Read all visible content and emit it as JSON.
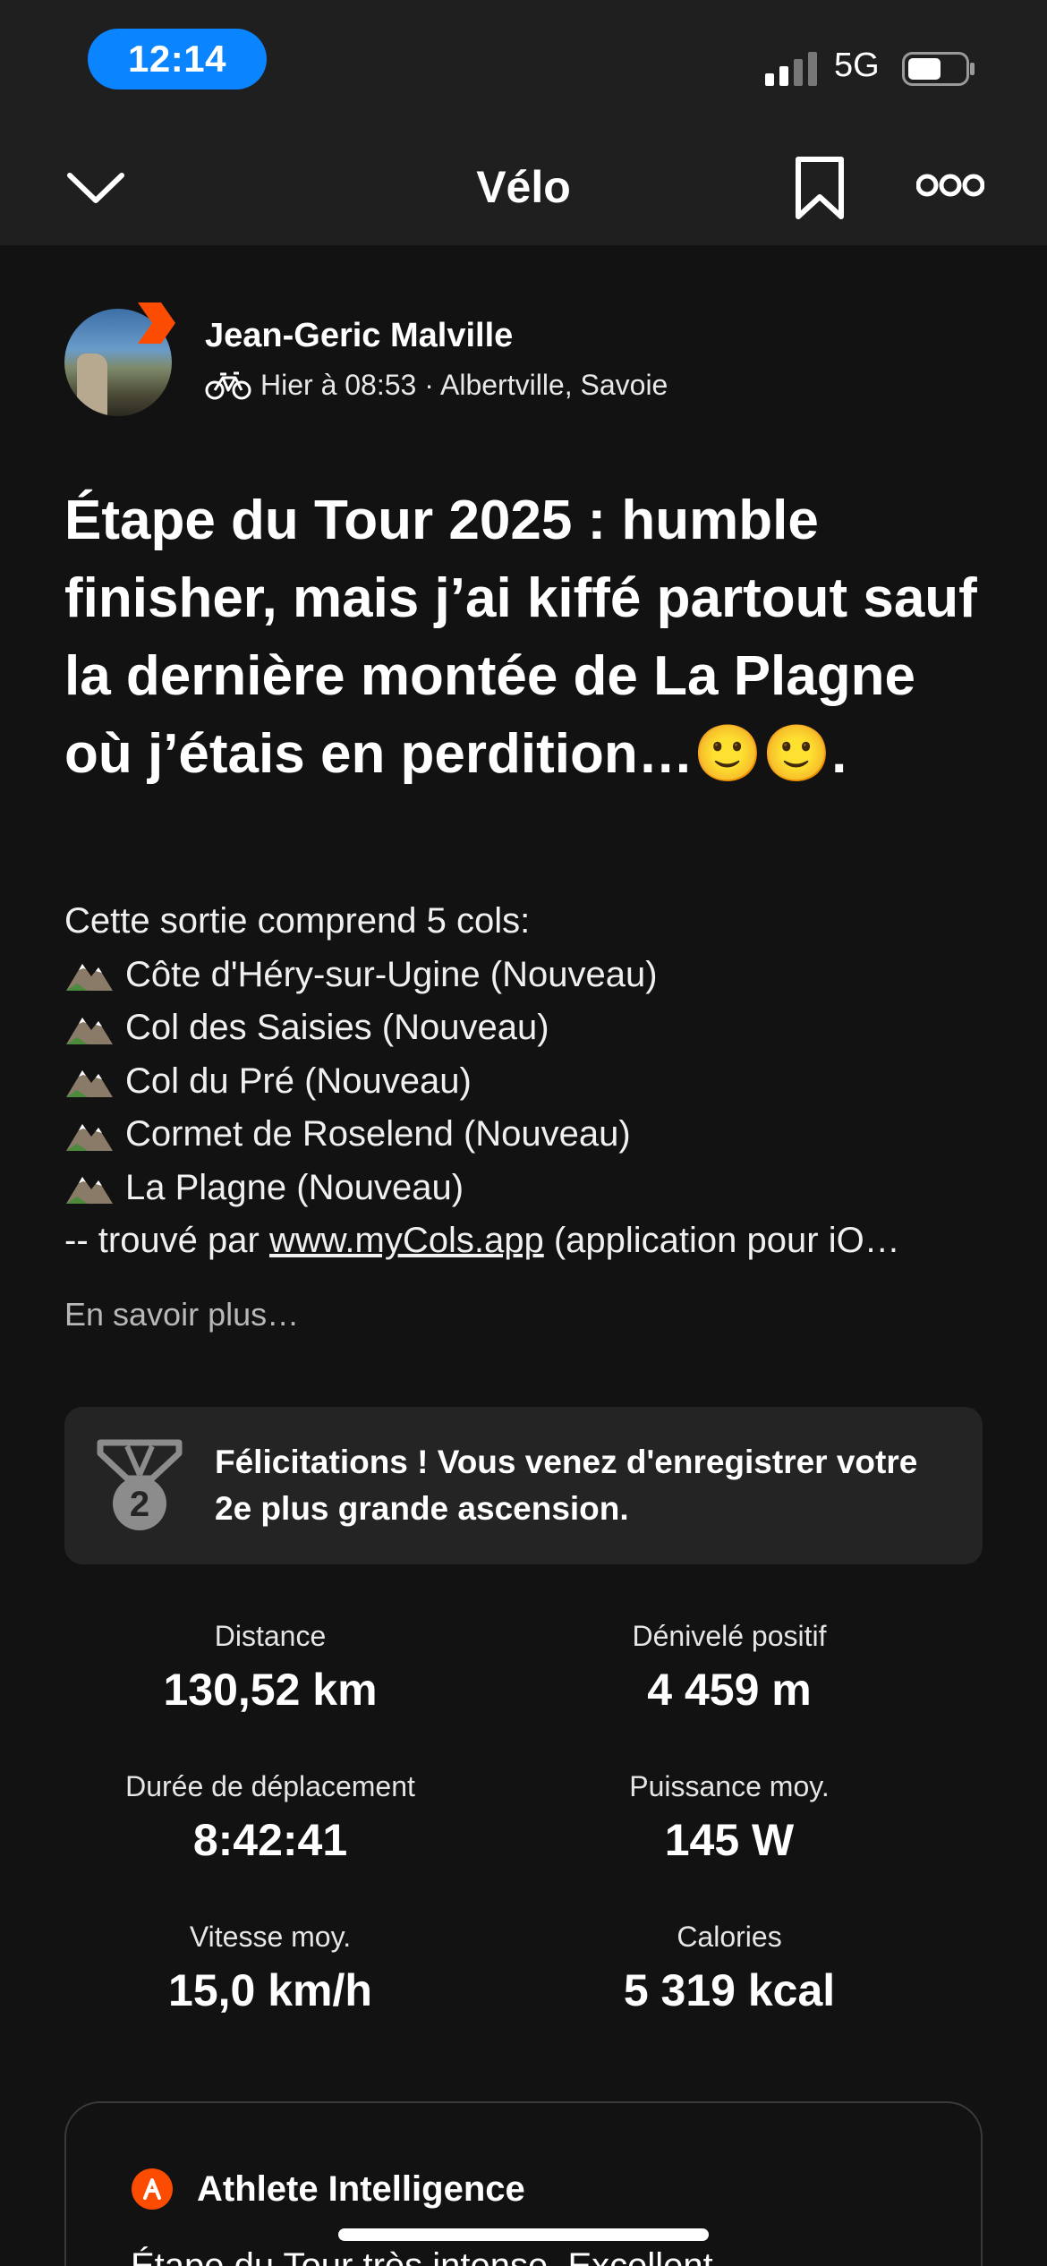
{
  "status_bar": {
    "time": "12:14",
    "network": "5G"
  },
  "nav": {
    "title": "Vélo"
  },
  "author": {
    "name": "Jean-Geric Malville",
    "meta": "Hier à 08:53 · Albertville, Savoie"
  },
  "post": {
    "title": "Étape du Tour 2025 : humble finisher, mais j’ai kiffé partout sauf la dernière montée de La Plagne où j’étais en perdition…🙂🙂.",
    "intro": "Cette sortie comprend 5 cols:",
    "cols": [
      "Côte d'Héry-sur-Ugine (Nouveau)",
      "Col des Saisies (Nouveau)",
      "Col du Pré (Nouveau)",
      "Cormet de Roselend (Nouveau)",
      "La Plagne (Nouveau)"
    ],
    "found_prefix": "-- trouvé par ",
    "found_link": "www.myCols.app",
    "found_suffix": " (application pour iO…",
    "read_more": "En savoir plus…"
  },
  "achievement": {
    "medal_number": "2",
    "text": "Félicitations ! Vous venez d'enregistrer votre 2e plus grande ascension."
  },
  "stats": [
    {
      "label": "Distance",
      "value": "130,52 km"
    },
    {
      "label": "Dénivelé positif",
      "value": "4 459 m"
    },
    {
      "label": "Durée de déplacement",
      "value": "8:42:41"
    },
    {
      "label": "Puissance moy.",
      "value": "145 W"
    },
    {
      "label": "Vitesse moy.",
      "value": "15,0 km/h"
    },
    {
      "label": "Calories",
      "value": "5 319 kcal"
    }
  ],
  "athlete_intelligence": {
    "title": "Athlete Intelligence",
    "peek": "Étape du Tour très intense. Excellent"
  },
  "colors": {
    "accent": "#fc4c02",
    "time_pill": "#0a84ff",
    "background": "#121212",
    "bar": "#1f1f1f"
  },
  "icons": [
    "chevron-down-icon",
    "bookmark-icon",
    "more-icon",
    "bike-icon",
    "mountain-icon",
    "medal-icon",
    "athlete-intelligence-icon",
    "signal-icon",
    "battery-icon"
  ]
}
